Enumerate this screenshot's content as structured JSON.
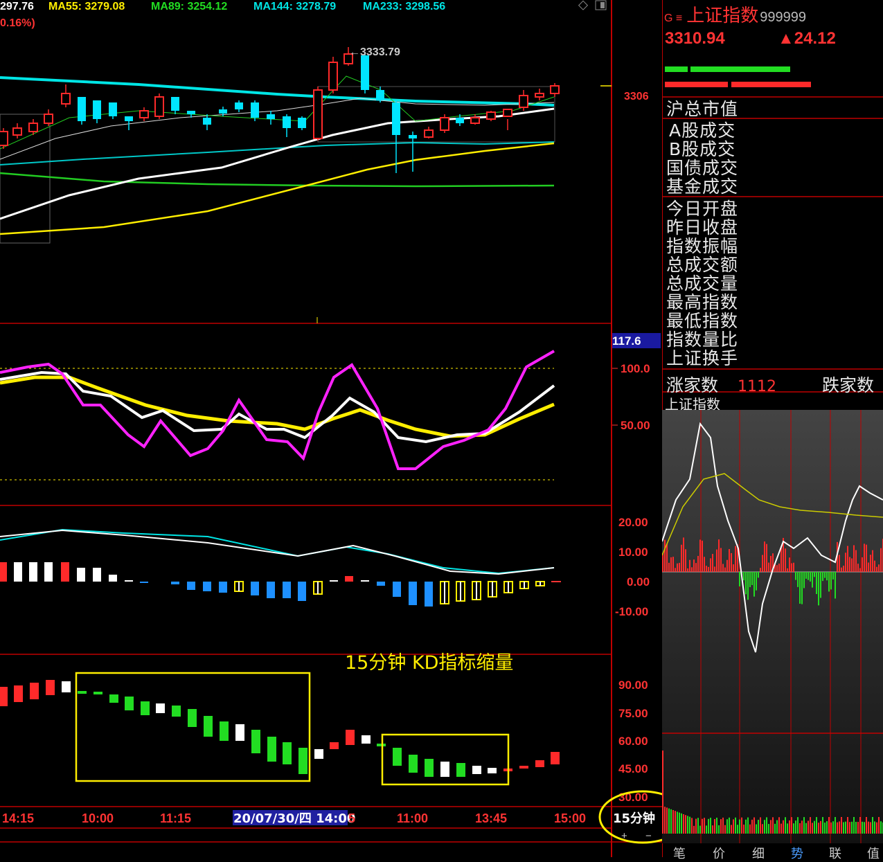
{
  "header": {
    "ma_prefix": "297.76",
    "ma55": "MA55: 3279.08",
    "ma89": "MA89: 3254.12",
    "ma144": "MA144: 3278.79",
    "ma233": "MA233: 3298.56",
    "pct": "0.16%)"
  },
  "main_chart": {
    "high_label": "3333.79",
    "price_tick": "3306"
  },
  "kdj": {
    "badge": "117.6",
    "ticks": [
      "100.0",
      "50.00"
    ]
  },
  "macd": {
    "ticks": [
      "20.00",
      "10.00",
      "0.00",
      "-10.00"
    ]
  },
  "kd_sub": {
    "annotation": "15分钟 KD指标缩量",
    "ticks": [
      "90.00",
      "75.00",
      "60.00",
      "45.00",
      "30.00"
    ]
  },
  "time_axis": {
    "labels": [
      "14:15",
      "10:00",
      "11:15",
      "5",
      "11:00",
      "13:45",
      "15:00"
    ],
    "cursor": "20/07/30/四 14:00",
    "period": "15分钟",
    "plus": "+",
    "minus": "−"
  },
  "quote": {
    "marker": "G ≡",
    "name": "上证指数",
    "code": "999999",
    "price": "3310.94",
    "change": "▲24.12"
  },
  "stats": {
    "total_cap": "沪总市值",
    "group1": [
      "A股成交",
      "B股成交",
      "国债成交",
      "基金成交"
    ],
    "group2": [
      "今日开盘",
      "昨日收盘",
      "指数振幅",
      "总成交额",
      "总成交量",
      "最高指数",
      "最低指数",
      "指数量比",
      "上证换手"
    ],
    "rise_label": "涨家数",
    "rise_count": "1112",
    "fall_label": "跌家数"
  },
  "mini_chart": {
    "title": "上证指数"
  },
  "bottom_tabs": [
    "笔",
    "价",
    "细",
    "势",
    "联",
    "值"
  ],
  "colors": {
    "up": "#ff2a2a",
    "down": "#00e5ff",
    "kd_down": "#22dd22",
    "ma_white": "#ffffff",
    "ma_yellow": "#ffee00",
    "ma_cyan": "#00e5e5",
    "ma_green": "#22cc22",
    "k_line": "#ff22ff",
    "annotation": "#ffee00",
    "grid_red": "#c00000"
  }
}
